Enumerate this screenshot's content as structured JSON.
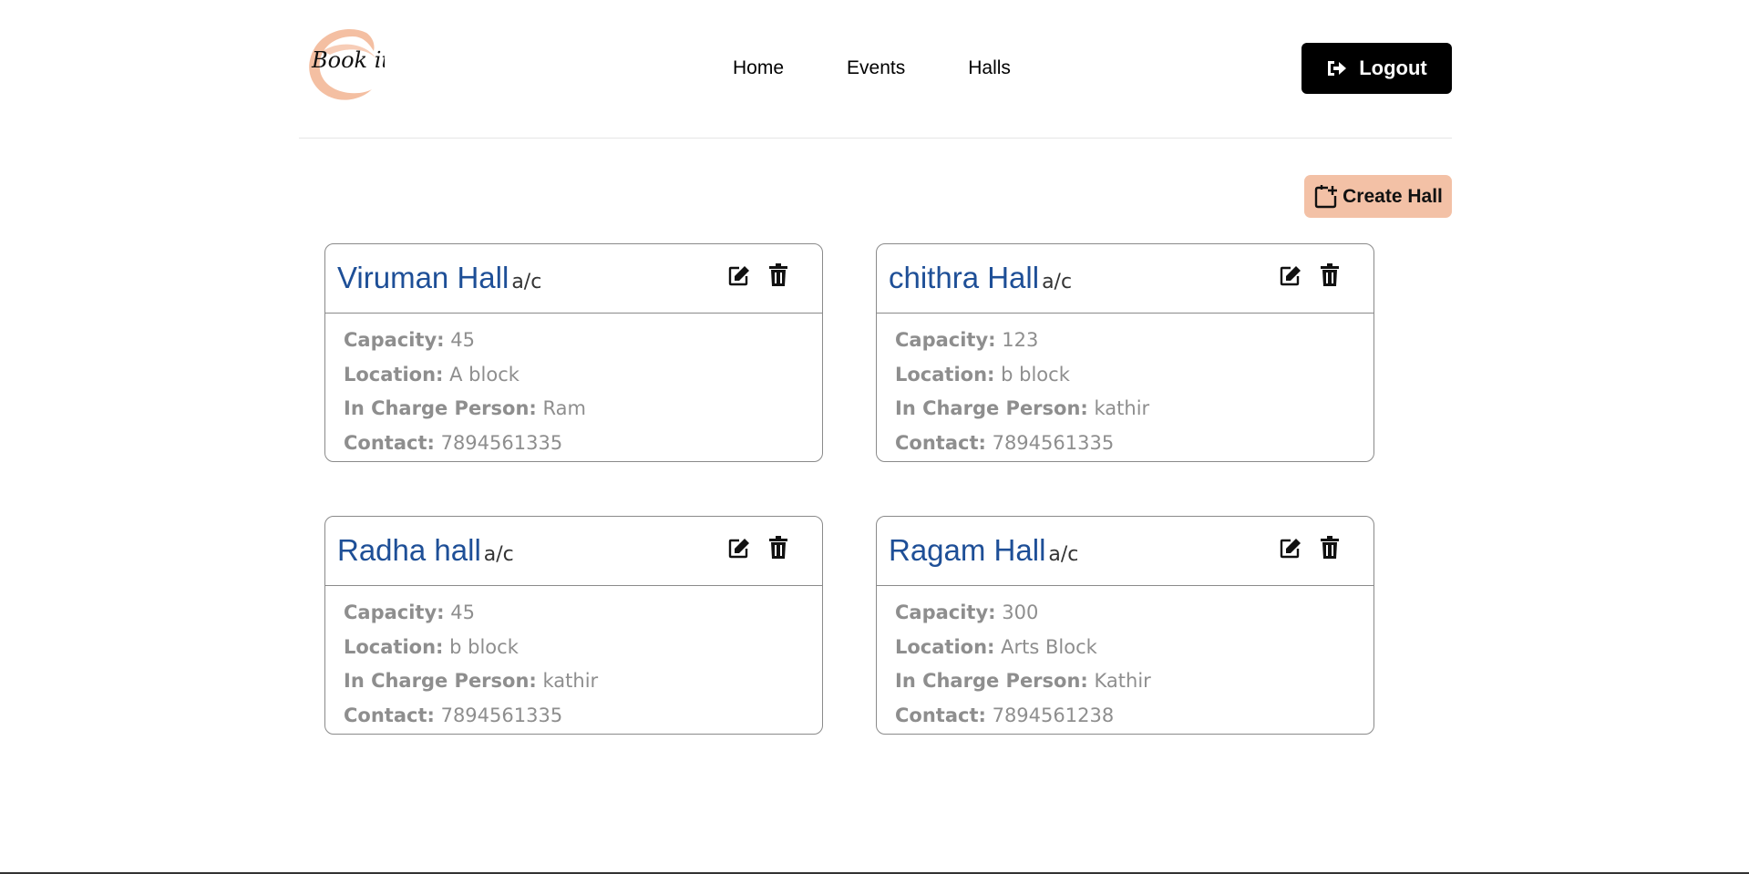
{
  "header": {
    "logo_text": "Book it",
    "nav": [
      {
        "label": "Home"
      },
      {
        "label": "Events"
      },
      {
        "label": "Halls"
      }
    ],
    "logout_label": "Logout"
  },
  "toolbar": {
    "create_label": "Create Hall"
  },
  "labels": {
    "capacity": "Capacity:",
    "location": "Location:",
    "in_charge": "In Charge Person:",
    "contact": "Contact:"
  },
  "halls": [
    {
      "name": "Viruman Hall",
      "type": "a/c",
      "capacity": "45",
      "location": "A block",
      "in_charge": "Ram",
      "contact": "7894561335"
    },
    {
      "name": "chithra Hall",
      "type": "a/c",
      "capacity": "123",
      "location": "b block",
      "in_charge": "kathir",
      "contact": "7894561335"
    },
    {
      "name": "Radha hall",
      "type": "a/c",
      "capacity": "45",
      "location": "b block",
      "in_charge": "kathir",
      "contact": "7894561335"
    },
    {
      "name": "Ragam Hall",
      "type": "a/c",
      "capacity": "300",
      "location": "Arts Block",
      "in_charge": "Kathir",
      "contact": "7894561238"
    }
  ],
  "colors": {
    "brand_peach": "#f3c1a6",
    "title_blue": "#1e4f97",
    "muted_text": "#8e8e8e"
  }
}
